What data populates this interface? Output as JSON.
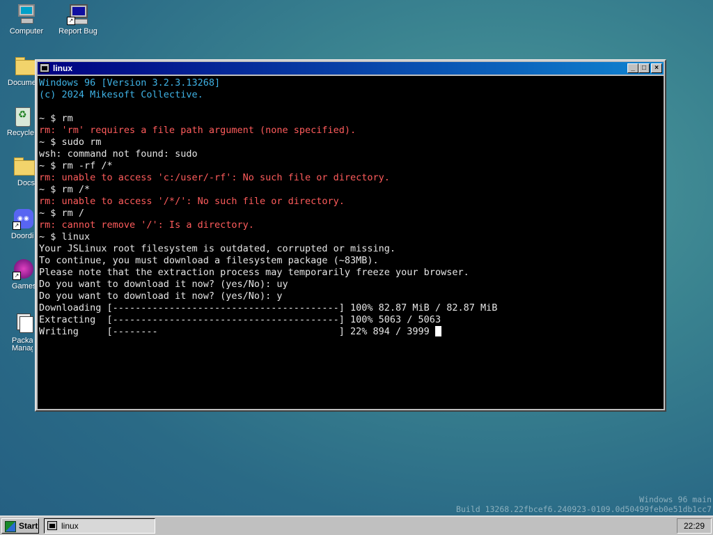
{
  "desktop": {
    "icons": [
      {
        "label": "Computer"
      },
      {
        "label": "Report Bug"
      },
      {
        "label": "Docume"
      },
      {
        "label": "Recycle"
      },
      {
        "label": "Docs"
      },
      {
        "label": "Doordi"
      },
      {
        "label": "Games"
      },
      {
        "label": "Packa Manag"
      }
    ]
  },
  "window": {
    "title": "linux",
    "buttons": {
      "minimize": "_",
      "maximize": "□",
      "close": "×"
    }
  },
  "terminal": {
    "lines": [
      {
        "text": "Windows 96 [Version 3.2.3.13268]",
        "color": "#3fb3e6"
      },
      {
        "text": "(c) 2024 Mikesoft Collective.",
        "color": "#3fb3e6"
      },
      {
        "text": "",
        "color": "#e6e6e6"
      },
      {
        "text": "~ $ rm",
        "color": "#e6e6e6"
      },
      {
        "text": "rm: 'rm' requires a file path argument (none specified).",
        "color": "#ff5c5c"
      },
      {
        "text": "~ $ sudo rm",
        "color": "#e6e6e6"
      },
      {
        "text": "wsh: command not found: sudo",
        "color": "#e6e6e6"
      },
      {
        "text": "~ $ rm -rf /*",
        "color": "#e6e6e6"
      },
      {
        "text": "rm: unable to access 'c:/user/-rf': No such file or directory.",
        "color": "#ff5c5c"
      },
      {
        "text": "~ $ rm /*",
        "color": "#e6e6e6"
      },
      {
        "text": "rm: unable to access '/*/': No such file or directory.",
        "color": "#ff5c5c"
      },
      {
        "text": "~ $ rm /",
        "color": "#e6e6e6"
      },
      {
        "text": "rm: cannot remove '/': Is a directory.",
        "color": "#ff5c5c"
      },
      {
        "text": "~ $ linux",
        "color": "#e6e6e6"
      },
      {
        "text": "Your JSLinux root filesystem is outdated, corrupted or missing.",
        "color": "#e6e6e6"
      },
      {
        "text": "To continue, you must download a filesystem package (~83MB).",
        "color": "#e6e6e6"
      },
      {
        "text": "Please note that the extraction process may temporarily freeze your browser.",
        "color": "#e6e6e6"
      },
      {
        "text": "Do you want to download it now? (yes/No): uy",
        "color": "#e6e6e6"
      },
      {
        "text": "Do you want to download it now? (yes/No): y",
        "color": "#e6e6e6"
      },
      {
        "text": "Downloading [----------------------------------------] 100% 82.87 MiB / 82.87 MiB",
        "color": "#e6e6e6"
      },
      {
        "text": "Extracting  [----------------------------------------] 100% 5063 / 5063",
        "color": "#e6e6e6"
      },
      {
        "text": "Writing     [--------                                ] 22% 894 / 3999 ",
        "color": "#e6e6e6"
      }
    ]
  },
  "watermark": {
    "line1": "Windows 96 main",
    "line2": "Build 13268.22fbcef6.240923-0109.0d50499feb0e51db1cc7"
  },
  "taskbar": {
    "start_label": "Start",
    "task_label": "linux",
    "clock": "22:29"
  }
}
